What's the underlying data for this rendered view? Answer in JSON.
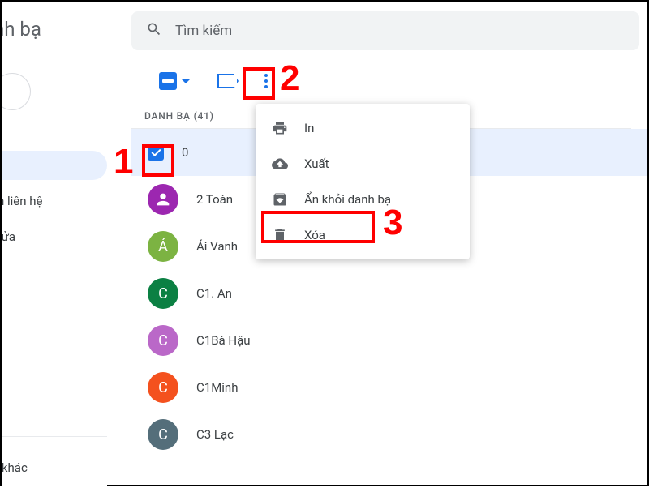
{
  "sidebar": {
    "title": "nh bạ",
    "items": [
      {
        "label": ""
      },
      {
        "label": "yên liên hệ"
      },
      {
        "label": "à sửa"
      }
    ],
    "other": "hệ khác"
  },
  "search": {
    "placeholder": "Tìm kiếm"
  },
  "section": {
    "header": "DANH BẠ (41)"
  },
  "menu": {
    "print": "In",
    "export": "Xuất",
    "hide": "Ẩn khỏi danh bạ",
    "delete": "Xóa"
  },
  "contacts": [
    {
      "name": "0",
      "initial": "",
      "color": "#1a73e8",
      "selected": true
    },
    {
      "name": "2 Toàn",
      "initial": "",
      "color": "#9c27b0",
      "selected": false,
      "blankAvatar": true
    },
    {
      "name": "Ái Vanh",
      "initial": "Á",
      "color": "#7cb342",
      "selected": false
    },
    {
      "name": "C1. An",
      "initial": "C",
      "color": "#0b8043",
      "selected": false
    },
    {
      "name": "C1Bà Hậu",
      "initial": "C",
      "color": "#ba68c8",
      "selected": false
    },
    {
      "name": "C1Minh",
      "initial": "C",
      "color": "#f4511e",
      "selected": false
    },
    {
      "name": "C3 Lạc",
      "initial": "C",
      "color": "#546e7a",
      "selected": false
    }
  ],
  "annotations": {
    "one": "1",
    "two": "2",
    "three": "3"
  }
}
